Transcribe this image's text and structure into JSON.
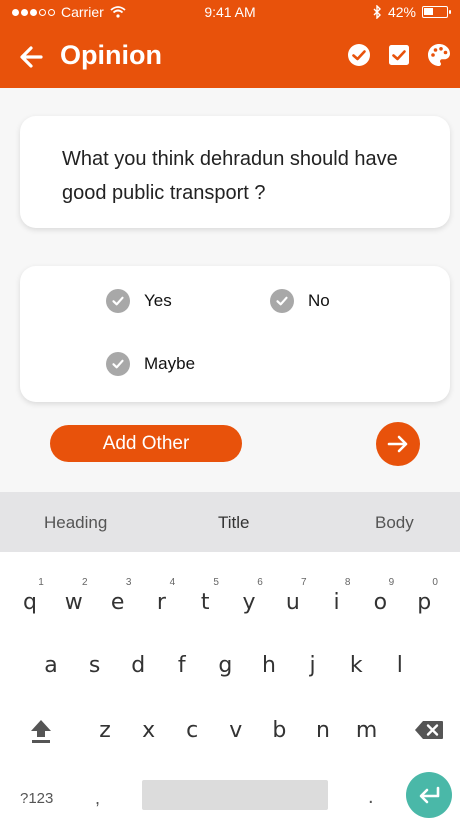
{
  "status": {
    "carrier": "Carrier",
    "time": "9:41 AM",
    "battery": "42%",
    "battery_level": 0.42
  },
  "appbar": {
    "title": "Opinion"
  },
  "question": {
    "text": "What you think dehradun should have good public transport ?"
  },
  "options": [
    {
      "label": "Yes"
    },
    {
      "label": "No"
    },
    {
      "label": "Maybe"
    }
  ],
  "buttons": {
    "add_other": "Add Other"
  },
  "keyboard": {
    "suggestions": [
      "Heading",
      "Title",
      "Body"
    ],
    "row1": [
      "q",
      "w",
      "e",
      "r",
      "t",
      "y",
      "u",
      "i",
      "o",
      "p"
    ],
    "row1_numbers": [
      "1",
      "2",
      "3",
      "4",
      "5",
      "6",
      "7",
      "8",
      "9",
      "0"
    ],
    "row2": [
      "a",
      "s",
      "d",
      "f",
      "g",
      "h",
      "j",
      "k",
      "l"
    ],
    "row3": [
      "z",
      "x",
      "c",
      "v",
      "b",
      "n",
      "m"
    ],
    "symbols_key": "?123",
    "comma_key": ",",
    "period_key": "."
  },
  "colors": {
    "brand": "#e8520b",
    "enter": "#4ab8a8",
    "check": "#a8a8a8"
  }
}
